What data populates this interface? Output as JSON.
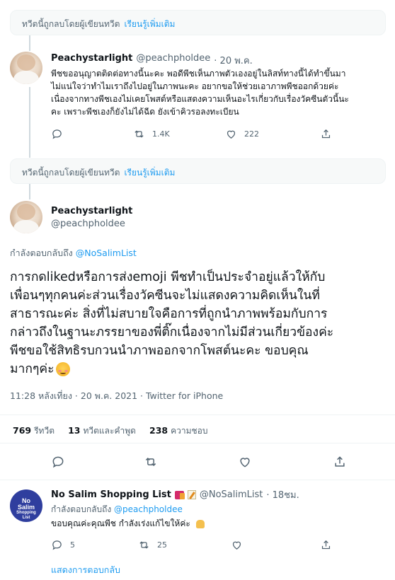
{
  "deleted_notice": {
    "text": "ทวีตนี้ถูกลบโดยผู้เขียนทวีต",
    "link": "เรียนรู้เพิ่มเติม"
  },
  "tweet1": {
    "name": "Peachystarlight",
    "handle": "@peachpholdee",
    "time": "· 20 พ.ค.",
    "lines": [
      "พีชขออนุญาตติดต่อทางนี้นะคะ พอดีพีชเห็นภาพตัวเองอยู่ในลิสท์ทางนี้ได้ทำขึ้นมา",
      "ไม่แน่ใจว่าทำไมเราถึงไปอยู่ในภาพนะคะ อยากขอให้ช่วยเอาภาพพีชออกด้วยค่ะ",
      "เนื่องจากทางพีชเองไม่เคยโพสต์หรือแสดงความเห็นอะไรเกี่ยวกับเรื่องวัคซีนตัวนี้นะ",
      "คะ เพราะพีชเองก็ยังไม่ได้ฉีด ยังเข้าคิวรอลงทะเบียน"
    ],
    "retweets": "1.4K",
    "likes": "222"
  },
  "main_tweet": {
    "name": "Peachystarlight",
    "handle": "@peachpholdee",
    "replying_prefix": "กำลังตอบกลับถึง",
    "replying_to": "@NoSalimList",
    "lines": [
      "การกดlikedหรือการส่งemoji พีชทำเป็นประจำอยู่แล้วให้กับ",
      "เพื่อนๆทุกคนค่ะส่วนเรื่องวัคซีนจะไม่แสดงความคิดเห็นในที่",
      "สาธารณะค่ะ สิ่งที่ไม่สบายใจคือการที่ถูกนำภาพพร้อมกับการ",
      "กล่าวถึงในฐานะภรรยาของพี่ติ๊กเนื่องจากไม่มีส่วนเกี่ยวข้องค่ะ",
      "พีชขอใช้สิทธิรบกวนนำภาพออกจากโพสต์นะคะ ขอบคุณ",
      "มากๆค่ะ"
    ],
    "timestamp": "11:28 หลังเที่ยง · 20 พ.ค. 2021 · Twitter for iPhone",
    "stats": {
      "retweets_num": "769",
      "retweets_lbl": "รีทวีต",
      "quotes_num": "13",
      "quotes_lbl": "ทวีตและคำพูด",
      "likes_num": "238",
      "likes_lbl": "ความชอบ"
    }
  },
  "reply": {
    "avatar_lines": [
      "No",
      "Salim",
      "Shopping",
      "List"
    ],
    "name": "No Salim Shopping List",
    "handle": "@NoSalimList",
    "time": "· 18ชม.",
    "replying_prefix": "กำลังตอบกลับถึง",
    "replying_to": "@peachpholdee",
    "text": "ขอบคุณค่ะคุณพีช กำลังเร่งแก้ไขให้ค่ะ",
    "comments": "5",
    "retweets": "25",
    "show_replies": "แสดงการตอบกลับ"
  },
  "colors": {
    "accent": "#1d9bf0",
    "muted": "#536471",
    "text": "#0f1419",
    "divider": "#eff3f4"
  },
  "icons": [
    "reply-icon",
    "retweet-icon",
    "like-icon",
    "share-icon",
    "shopping-bags-icon",
    "memo-icon",
    "smiling-blush-icon",
    "folded-hands-icon"
  ]
}
